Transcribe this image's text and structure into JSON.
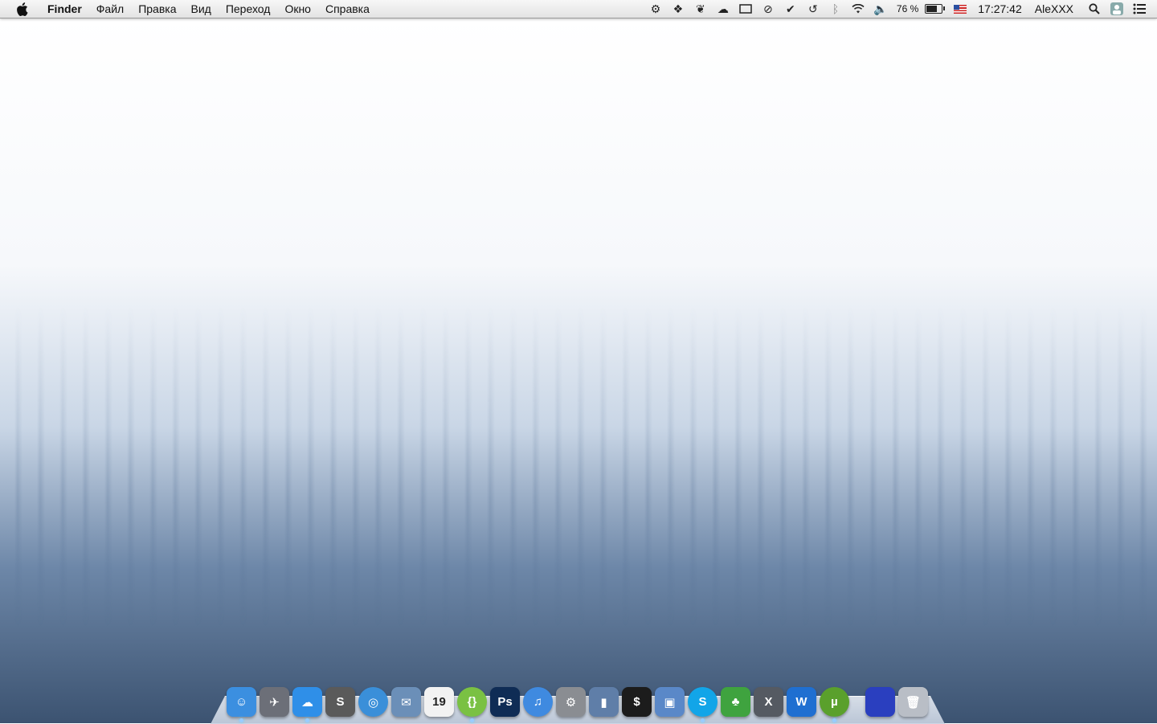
{
  "menubar": {
    "app_name": "Finder",
    "menus": [
      "Файл",
      "Правка",
      "Вид",
      "Переход",
      "Окно",
      "Справка"
    ],
    "status": {
      "icons": [
        "gear-icon",
        "dropbox-icon",
        "evernote-icon",
        "cloud-app-icon",
        "display-icon",
        "do-not-disturb-icon",
        "checkmark-icon",
        "time-machine-icon",
        "bluetooth-icon",
        "wifi-icon",
        "volume-icon"
      ],
      "battery_percent": "76 %",
      "battery_level": 0.76,
      "input_source": "us-flag-icon",
      "clock": "17:27:42",
      "user": "AleXXX",
      "extra_icons": [
        "spotlight-icon",
        "user-avatar-icon",
        "notification-center-icon"
      ]
    }
  },
  "dock": {
    "apps": [
      {
        "name": "finder",
        "color": "#3b8fe0",
        "glyph": "☺",
        "running": true
      },
      {
        "name": "launchpad",
        "color": "#6c6f78",
        "glyph": "✈",
        "running": false
      },
      {
        "name": "cloud-app",
        "color": "#2f8fe8",
        "glyph": "☁",
        "running": true
      },
      {
        "name": "sublime-text",
        "color": "#5a5a5a",
        "glyph": "S",
        "running": false
      },
      {
        "name": "safari",
        "color": "#3a8fd9",
        "glyph": "◎",
        "running": false
      },
      {
        "name": "mail",
        "color": "#6b8fb8",
        "glyph": "✉",
        "running": false
      },
      {
        "name": "calendar",
        "color": "#f2f2f2",
        "glyph": "19",
        "running": false
      },
      {
        "name": "brackets",
        "color": "#7ac143",
        "glyph": "{}",
        "running": true
      },
      {
        "name": "photoshop",
        "color": "#0f2c55",
        "glyph": "Ps",
        "running": false
      },
      {
        "name": "itunes",
        "color": "#3f8ae0",
        "glyph": "♫",
        "running": false
      },
      {
        "name": "system-preferences",
        "color": "#8a8d92",
        "glyph": "⚙",
        "running": false
      },
      {
        "name": "activity-monitor",
        "color": "#5f7ea8",
        "glyph": "▮",
        "running": false
      },
      {
        "name": "terminal",
        "color": "#1c1c1c",
        "glyph": "$",
        "running": false
      },
      {
        "name": "remote-desktop",
        "color": "#5a88c8",
        "glyph": "▣",
        "running": false
      },
      {
        "name": "skype",
        "color": "#12a5e8",
        "glyph": "S",
        "running": true
      },
      {
        "name": "adium",
        "color": "#3fa33f",
        "glyph": "♣",
        "running": false
      },
      {
        "name": "xcode",
        "color": "#555a62",
        "glyph": "X",
        "running": false
      },
      {
        "name": "word",
        "color": "#1f6fd1",
        "glyph": "W",
        "running": false
      },
      {
        "name": "utorrent",
        "color": "#5aa02c",
        "glyph": "µ",
        "running": true
      },
      {
        "name": "desktop-folder",
        "color": "#2a3fbf",
        "glyph": "",
        "running": false
      },
      {
        "name": "trash",
        "color": "#b9bec6",
        "glyph": "🗑",
        "running": false
      }
    ]
  }
}
